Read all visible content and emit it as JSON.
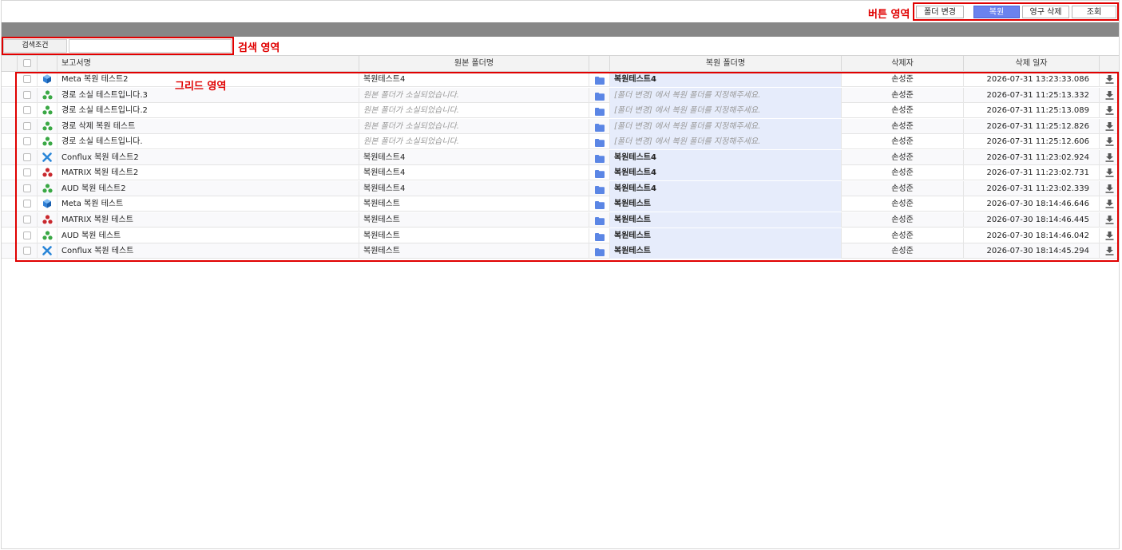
{
  "annotations": {
    "button_area": "버튼 영역",
    "search_area": "검색 영역",
    "grid_area": "그리드 영역"
  },
  "toolbar": {
    "change_folder": "폴더 변경",
    "restore": "복원",
    "permanent_delete": "영구 삭제",
    "search": "조회"
  },
  "search": {
    "label": "검색조건",
    "value": ""
  },
  "grid": {
    "columns": [
      "보고서명",
      "원본 폴더명",
      "복원 폴더명",
      "삭제자",
      "삭제 일자"
    ],
    "rows": [
      {
        "icon": "meta-cube-icon",
        "name": "Meta 복원 테스트2",
        "orig": "복원테스트4",
        "orig_missing": false,
        "restore": "복원테스트4",
        "restore_missing": false,
        "deleter": "손성준",
        "date": "2026-07-31 13:23:33.086"
      },
      {
        "icon": "aud-green-icon",
        "name": "경로 소실 테스트입니다.3",
        "orig": "원본 폴더가 소실되었습니다.",
        "orig_missing": true,
        "restore": "[폴더 변경] 에서 복원 폴더를 지정해주세요.",
        "restore_missing": true,
        "deleter": "손성준",
        "date": "2026-07-31 11:25:13.332"
      },
      {
        "icon": "aud-green-icon",
        "name": "경로 소실 테스트입니다.2",
        "orig": "원본 폴더가 소실되었습니다.",
        "orig_missing": true,
        "restore": "[폴더 변경] 에서 복원 폴더를 지정해주세요.",
        "restore_missing": true,
        "deleter": "손성준",
        "date": "2026-07-31 11:25:13.089"
      },
      {
        "icon": "aud-green-icon",
        "name": "경로 삭제 복원 테스트",
        "orig": "원본 폴더가 소실되었습니다.",
        "orig_missing": true,
        "restore": "[폴더 변경] 에서 복원 폴더를 지정해주세요.",
        "restore_missing": true,
        "deleter": "손성준",
        "date": "2026-07-31 11:25:12.826"
      },
      {
        "icon": "aud-green-icon",
        "name": "경로 소실 테스트입니다.",
        "orig": "원본 폴더가 소실되었습니다.",
        "orig_missing": true,
        "restore": "[폴더 변경] 에서 복원 폴더를 지정해주세요.",
        "restore_missing": true,
        "deleter": "손성준",
        "date": "2026-07-31 11:25:12.606"
      },
      {
        "icon": "conflux-x-icon",
        "name": "Conflux 복원 테스트2",
        "orig": "복원테스트4",
        "orig_missing": false,
        "restore": "복원테스트4",
        "restore_missing": false,
        "deleter": "손성준",
        "date": "2026-07-31 11:23:02.924"
      },
      {
        "icon": "matrix-red-icon",
        "name": "MATRIX 복원 테스트2",
        "orig": "복원테스트4",
        "orig_missing": false,
        "restore": "복원테스트4",
        "restore_missing": false,
        "deleter": "손성준",
        "date": "2026-07-31 11:23:02.731"
      },
      {
        "icon": "aud-green-icon",
        "name": "AUD 복원 테스트2",
        "orig": "복원테스트4",
        "orig_missing": false,
        "restore": "복원테스트4",
        "restore_missing": false,
        "deleter": "손성준",
        "date": "2026-07-31 11:23:02.339"
      },
      {
        "icon": "meta-cube-icon",
        "name": "Meta 복원 테스트",
        "orig": "복원테스트",
        "orig_missing": false,
        "restore": "복원테스트",
        "restore_missing": false,
        "deleter": "손성준",
        "date": "2026-07-30 18:14:46.646"
      },
      {
        "icon": "matrix-red-icon",
        "name": "MATRIX 복원 테스트",
        "orig": "복원테스트",
        "orig_missing": false,
        "restore": "복원테스트",
        "restore_missing": false,
        "deleter": "손성준",
        "date": "2026-07-30 18:14:46.445"
      },
      {
        "icon": "aud-green-icon",
        "name": "AUD 복원 테스트",
        "orig": "복원테스트",
        "orig_missing": false,
        "restore": "복원테스트",
        "restore_missing": false,
        "deleter": "손성준",
        "date": "2026-07-30 18:14:46.042"
      },
      {
        "icon": "conflux-x-icon",
        "name": "Conflux 복원 테스트",
        "orig": "복원테스트",
        "orig_missing": false,
        "restore": "복원테스트",
        "restore_missing": false,
        "deleter": "손성준",
        "date": "2026-07-30 18:14:45.294"
      }
    ]
  },
  "colors": {
    "annotation_red": "#e00000",
    "primary_button": "#6b82ee",
    "folder_icon": "#5b86e5",
    "restore_cell_bg": "#e6ecfb",
    "header_bar": "#878787"
  }
}
